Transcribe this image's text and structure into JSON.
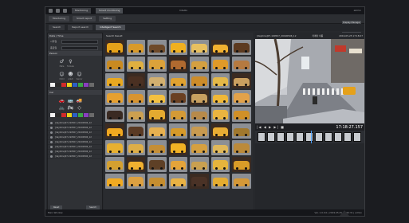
{
  "app": {
    "title_center": "Intellio",
    "title_right": "admin",
    "tabs": [
      "Monitoring",
      "Smart monitoring"
    ]
  },
  "toolbar": {
    "buttons": [
      "Monitoring",
      "Smart report",
      "Setting"
    ]
  },
  "right_buttons": [
    "Display Manager",
    "Export",
    "Screen Capture"
  ],
  "subtabs": [
    "Search",
    "Report search",
    "Intelligent Search"
  ],
  "left": {
    "date_header": "Date / Time",
    "from_label": "시작일",
    "to_label": "종료일",
    "person_header": "Person",
    "person_types": [
      "Male",
      "Female"
    ],
    "ages": [
      "Child",
      "Adult",
      "Senior"
    ],
    "person_colors": [
      "#f1f1f1",
      "#2a2a2a",
      "#d12a2a",
      "#e8d21a",
      "#2a60c8",
      "#3aa845",
      "#8a3ec0",
      "#6b6b6b"
    ],
    "vehicle_header": "Car",
    "vehicle_types": [
      "Car",
      "Bus",
      "Truck",
      "Bicycle",
      "Motorcycle",
      "Other"
    ],
    "vehicle_colors": [
      "#f1f1f1",
      "#2a2a2a",
      "#d12a2a",
      "#e8d21a",
      "#2a60c8",
      "#3aa845",
      "#8a3ec0",
      "#6b6b6b"
    ],
    "cameras": [
      "[daytime]07-190507_20190506_12",
      "[daytime]07-190507_20190506_12",
      "[daytime]07-190507_20190506_12",
      "[daytime]07-190507_20190506_12",
      "[daytime]07-190507_20190506_12",
      "[daytime]07-190507_20190506_12",
      "[daytime]07-190507_20190506_12",
      "[daytime]07-190507_20190506_12"
    ],
    "reset_label": "Reset",
    "search_label": "Search"
  },
  "grid": {
    "title": "Search Result",
    "thumbs": [
      "#e6a21a",
      "#d99a2a",
      "#6e4a2a",
      "#f0b020",
      "#e8c060",
      "#f2b030",
      "#5c3a20",
      "#c98a20",
      "#e0b040",
      "#dca23a",
      "#b06a30",
      "#d4a040",
      "#e09a28",
      "#b57a40",
      "#e8a820",
      "#4a3022",
      "#d2b070",
      "#e0a230",
      "#cc8c2a",
      "#e4b848",
      "#caa060",
      "#e6a030",
      "#d89430",
      "#f4c040",
      "#6a4022",
      "#c8a060",
      "#f0b838",
      "#e2a24a",
      "#3a2a22",
      "#cca050",
      "#e4aa30",
      "#d49a36",
      "#b88a4a",
      "#eab440",
      "#d09028",
      "#f0a820",
      "#5a3a24",
      "#e6b050",
      "#d69a2a",
      "#c89a50",
      "#e8ac34",
      "#a0782e",
      "#e8b030",
      "#deae48",
      "#c48e36",
      "#f2b224",
      "#d6a040",
      "#e0b85a",
      "#bb8a3a",
      "#d4a030",
      "#f0b030",
      "#5e4026",
      "#e4a43a",
      "#c9a050",
      "#e6b43c",
      "#d89c28",
      "#f0aa22",
      "#dca040",
      "#c58e30",
      "#e8b244",
      "#4a3226",
      "#e4ac30",
      "#d49838"
    ]
  },
  "viewer": {
    "camera_name": "[daytime]07-190507_20190506_12",
    "camera_label": "카메라 이름",
    "timestamp": "2019-05-25 17:18:27",
    "controls": "|◀ ◀ ▶ ▶| ■",
    "playtime": "17:18:27.157"
  },
  "status": {
    "left": "Main Window",
    "right": "Ver. 1.0.0.0 | 2019.05.25 11:50:31 | admin"
  }
}
